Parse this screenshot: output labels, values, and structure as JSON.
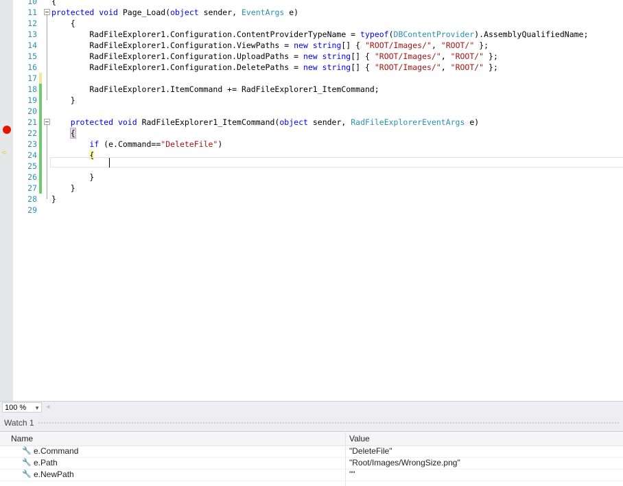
{
  "editor": {
    "lines": [
      {
        "n": "10",
        "html": "{"
      },
      {
        "n": "11",
        "html": "<span class='kw'>protected</span> <span class='kw'>void</span> Page_Load(<span class='kw'>object</span> sender, <span class='ty'>EventArgs</span> e)"
      },
      {
        "n": "12",
        "html": "    {"
      },
      {
        "n": "13",
        "html": "        RadFileExplorer1.Configuration.ContentProviderTypeName = <span class='kw'>typeof</span>(<span class='ty'>DBContentProvider</span>).AssemblyQualifiedName;"
      },
      {
        "n": "14",
        "html": "        RadFileExplorer1.Configuration.ViewPaths = <span class='kw'>new</span> <span class='kw'>string</span>[] { <span class='st'>\"ROOT/Images/\"</span>, <span class='st'>\"ROOT/\"</span> };"
      },
      {
        "n": "15",
        "html": "        RadFileExplorer1.Configuration.UploadPaths = <span class='kw'>new</span> <span class='kw'>string</span>[] { <span class='st'>\"ROOT/Images/\"</span>, <span class='st'>\"ROOT/\"</span> };"
      },
      {
        "n": "16",
        "html": "        RadFileExplorer1.Configuration.DeletePaths = <span class='kw'>new</span> <span class='kw'>string</span>[] { <span class='st'>\"ROOT/Images/\"</span>, <span class='st'>\"ROOT/\"</span> };"
      },
      {
        "n": "17",
        "html": ""
      },
      {
        "n": "18",
        "html": "        RadFileExplorer1.ItemCommand += RadFileExplorer1_ItemCommand;"
      },
      {
        "n": "19",
        "html": "    }"
      },
      {
        "n": "20",
        "html": ""
      },
      {
        "n": "21",
        "html": "    <span class='kw'>protected</span> <span class='kw'>void</span> RadFileExplorer1_ItemCommand(<span class='kw'>object</span> sender, <span class='ty'>RadFileExplorerEventArgs</span> e)"
      },
      {
        "n": "22",
        "html": "    <span class='hl-brace'>{</span>"
      },
      {
        "n": "23",
        "html": "        <span class='kw'>if</span> (e.Command==<span class='st'>\"DeleteFile\"</span>)"
      },
      {
        "n": "24",
        "html": "        <span class='hl-brace2'>{</span>"
      },
      {
        "n": "25",
        "html": ""
      },
      {
        "n": "26",
        "html": "        }"
      },
      {
        "n": "27",
        "html": "    }"
      },
      {
        "n": "28",
        "html": "}"
      },
      {
        "n": "29",
        "html": ""
      }
    ]
  },
  "status": {
    "zoom": "100 %"
  },
  "watch": {
    "title": "Watch 1",
    "columns": {
      "name": "Name",
      "value": "Value"
    },
    "rows": [
      {
        "name": "e.Command",
        "value": "\"DeleteFile\""
      },
      {
        "name": "e.Path",
        "value": "\"Root/Images/WrongSize.png\""
      },
      {
        "name": "e.NewPath",
        "value": "\"\""
      }
    ]
  }
}
